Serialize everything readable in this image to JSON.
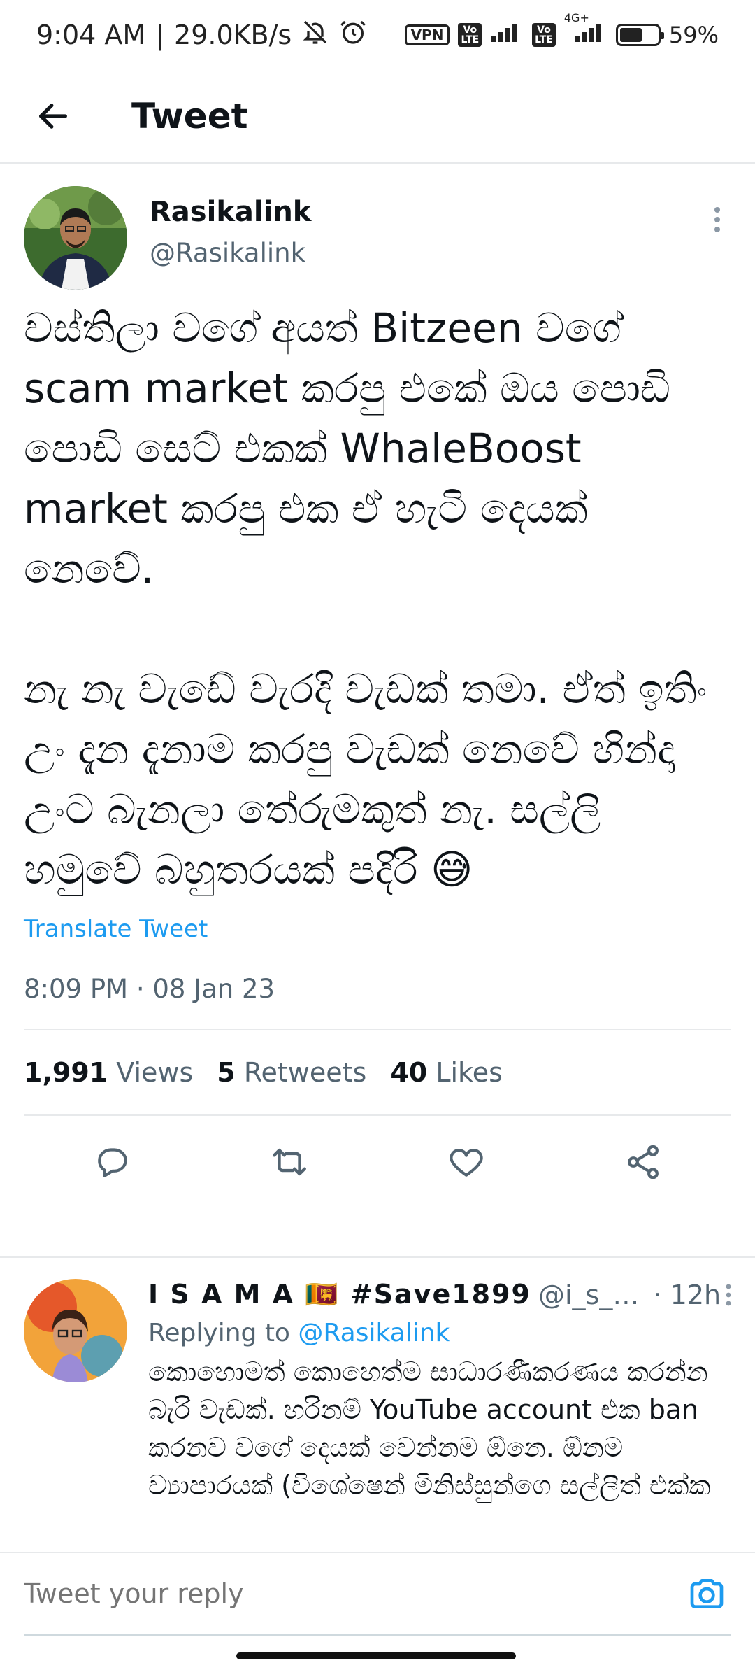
{
  "status_bar": {
    "time": "9:04 AM",
    "network_speed": "29.0KB/s",
    "vpn": "VPN",
    "volte1": "Vo\nLTE",
    "volte2": "Vo\nLTE",
    "net_type": "4G+",
    "battery_pct_label": "59%",
    "battery_level": 0.59
  },
  "header": {
    "title": "Tweet"
  },
  "tweet": {
    "author_name": "Rasikalink",
    "author_handle": "@Rasikalink",
    "text": "වස්තිලා වගේ අයත් Bitzeen වගේ scam market කරපු එකේ ඔය පොඩි පොඩි සෙට් එකක් WhaleBoost market කරපු එක ඒ හැටි දෙයක් නෙවේ.\n\nනැ නැ වැඩේ වැරදි වැඩක් තමා. ඒත් ඉතිං උං දැන දැනාම කරපු වැඩක් නෙවේ හින්දා උංට බැනලා තේරුමකුත් නැ. සල්ලි හමුවේ බහුතරයක් පදිරි 😅",
    "translate_label": "Translate Tweet",
    "timestamp": "8:09 PM · 08 Jan 23",
    "stats": {
      "views_count": "1,991",
      "views_label": "Views",
      "retweets_count": "5",
      "retweets_label": "Retweets",
      "likes_count": "40",
      "likes_label": "Likes"
    }
  },
  "reply": {
    "name": "I S A M A 🇱🇰 #Save1899",
    "handle": "@i_s_a_m...",
    "time": "· 12h",
    "replying_prefix": "Replying to",
    "replying_to": "@Rasikalink",
    "text": "කොහොමත් කොහෙත්ම සාධාරණීකරණය කරන්න බැරි වැඩක්. හරිනම් YouTube account එක ban කරනව වගේ දෙයක් වෙන්නම ඕනෙ. ඕනම ව්‍යාපාරයක් (විශේෂෙන් මිනිස්සුන්ගෙ සල්ලිත් එක්ක"
  },
  "compose": {
    "placeholder": "Tweet your reply"
  },
  "colors": {
    "accent": "#1d9bf0",
    "secondary_text": "#536471",
    "primary_text": "#0f1419",
    "divider": "#e7e9eb"
  }
}
